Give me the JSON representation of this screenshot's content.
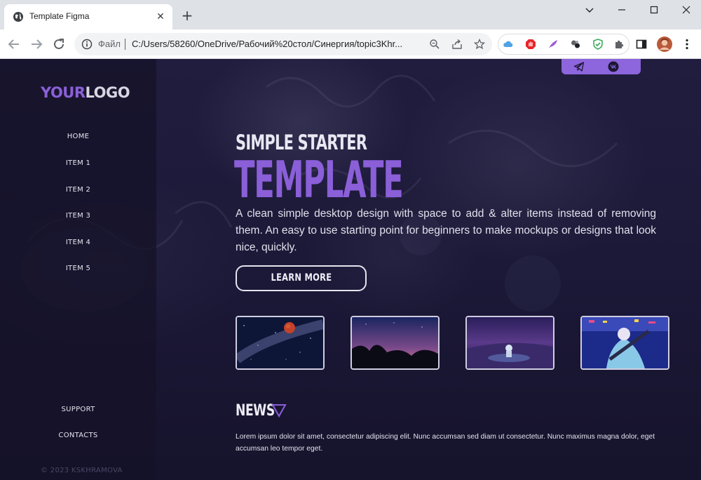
{
  "browser": {
    "tab_title": "Template Figma",
    "file_label": "Файл",
    "url": "C:/Users/58260/OneDrive/Рабочий%20стол/Синергия/topic3Khr..."
  },
  "sidebar": {
    "logo_accent": "YOUR",
    "logo_main": "LOGO",
    "nav": [
      "HOME",
      "ITEM 1",
      "ITEM 2",
      "ITEM 3",
      "ITEM 4",
      "ITEM 5"
    ],
    "bottom_nav": [
      "SUPPORT",
      "CONTACTS"
    ],
    "copyright": "© 2023 KSKHRAMOVA"
  },
  "hero": {
    "subtitle": "SIMPLE STARTER",
    "title": "TEMPLATE",
    "description": "A clean simple desktop design with space to add & alter items instead of removing them. An easy to use starting point for beginners to make mockups or designs that look nice, quickly.",
    "button_label": "LEARN MORE"
  },
  "thumbnails": [
    "blood-moon-starry-sky",
    "mountains-sunset-sky",
    "astronaut-purple-landscape",
    "musician-neon-city"
  ],
  "social": [
    "telegram-icon",
    "vk-icon"
  ],
  "news": {
    "title": "NEWS",
    "text": "Lorem ipsum dolor sit amet, consectetur adipiscing elit. Nunc accumsan sed diam ut consectetur. Nunc maximus magna dolor, eget accumsan leo tempor eget."
  },
  "colors": {
    "accent": "#8a5fd8",
    "background": "#1b1837",
    "text": "#e6e4ef"
  }
}
